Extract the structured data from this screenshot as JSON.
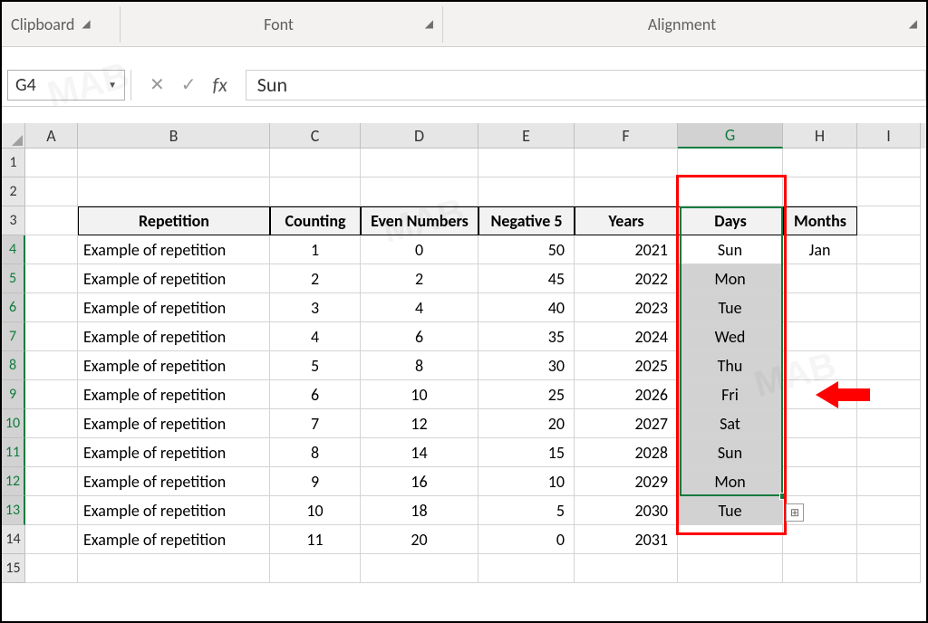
{
  "ribbon": {
    "clipboard": "Clipboard",
    "font": "Font",
    "alignment": "Alignment"
  },
  "formula_bar": {
    "name_box": "G4",
    "fx": "fx",
    "value": "Sun"
  },
  "columns": [
    "A",
    "B",
    "C",
    "D",
    "E",
    "F",
    "G",
    "H",
    "I"
  ],
  "active_column": "G",
  "active_rows": [
    4,
    5,
    6,
    7,
    8,
    9,
    10,
    11,
    12,
    13
  ],
  "headers": {
    "B": "Repetition",
    "C": "Counting",
    "D": "Even Numbers",
    "E": "Negative 5",
    "F": "Years",
    "G": "Days",
    "H": "Months"
  },
  "rows": [
    {
      "n": 1
    },
    {
      "n": 2
    },
    {
      "n": 3,
      "header": true
    },
    {
      "n": 4,
      "B": "Example of repetition",
      "C": "1",
      "D": "0",
      "E": "50",
      "F": "2021",
      "G": "Sun",
      "H": "Jan"
    },
    {
      "n": 5,
      "B": "Example of repetition",
      "C": "2",
      "D": "2",
      "E": "45",
      "F": "2022",
      "G": "Mon"
    },
    {
      "n": 6,
      "B": "Example of repetition",
      "C": "3",
      "D": "4",
      "E": "40",
      "F": "2023",
      "G": "Tue"
    },
    {
      "n": 7,
      "B": "Example of repetition",
      "C": "4",
      "D": "6",
      "E": "35",
      "F": "2024",
      "G": "Wed"
    },
    {
      "n": 8,
      "B": "Example of repetition",
      "C": "5",
      "D": "8",
      "E": "30",
      "F": "2025",
      "G": "Thu"
    },
    {
      "n": 9,
      "B": "Example of repetition",
      "C": "6",
      "D": "10",
      "E": "25",
      "F": "2026",
      "G": "Fri"
    },
    {
      "n": 10,
      "B": "Example of repetition",
      "C": "7",
      "D": "12",
      "E": "20",
      "F": "2027",
      "G": "Sat"
    },
    {
      "n": 11,
      "B": "Example of repetition",
      "C": "8",
      "D": "14",
      "E": "15",
      "F": "2028",
      "G": "Sun"
    },
    {
      "n": 12,
      "B": "Example of repetition",
      "C": "9",
      "D": "16",
      "E": "10",
      "F": "2029",
      "G": "Mon"
    },
    {
      "n": 13,
      "B": "Example of repetition",
      "C": "10",
      "D": "18",
      "E": "5",
      "F": "2030",
      "G": "Tue"
    },
    {
      "n": 14,
      "B": "Example of repetition",
      "C": "11",
      "D": "20",
      "E": "0",
      "F": "2031"
    },
    {
      "n": 15
    }
  ]
}
